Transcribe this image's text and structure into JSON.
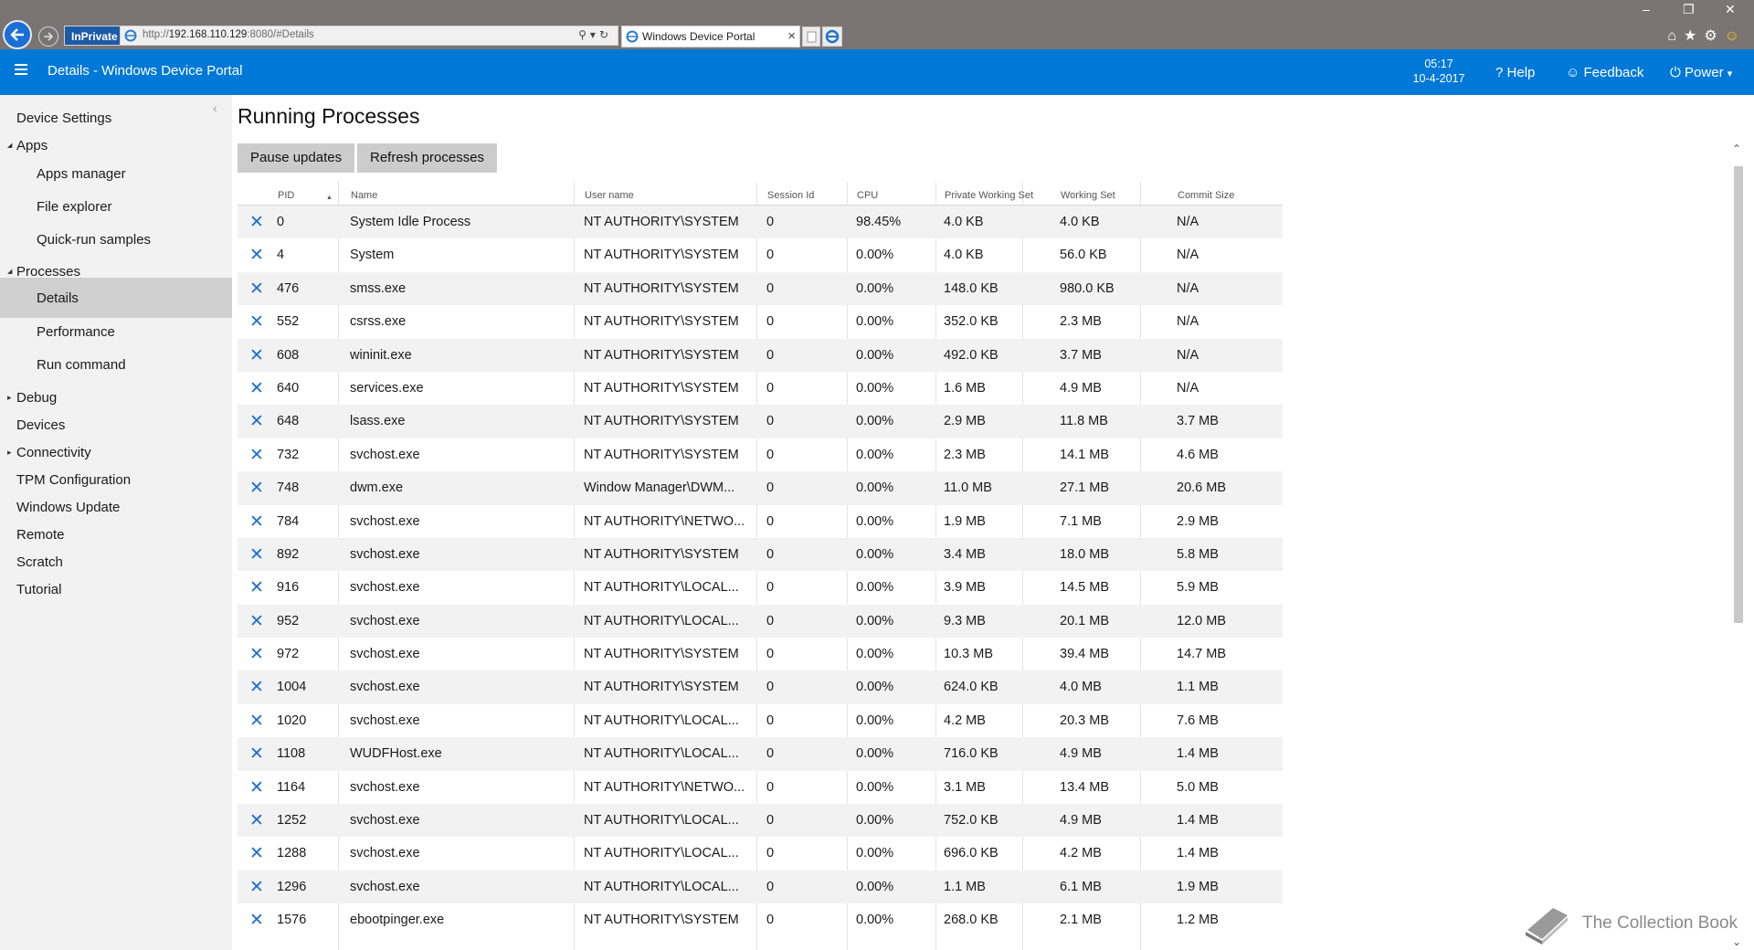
{
  "browser": {
    "inprivate_label": "InPrivate",
    "url_prefix": "http://",
    "url_host": "192.168.110.129",
    "url_suffix": ":8080/#Details",
    "tab_title": "Windows Device Portal"
  },
  "appbar": {
    "title": "Details - Windows Device Portal",
    "time": "05:17",
    "date": "10-4-2017",
    "help": "Help",
    "feedback": "Feedback",
    "power": "Power"
  },
  "sidebar": {
    "items": [
      {
        "label": "Device Settings",
        "level": 0,
        "caret": ""
      },
      {
        "label": "Apps",
        "level": 0,
        "caret": "down"
      },
      {
        "label": "Apps manager",
        "level": 1,
        "caret": ""
      },
      {
        "label": "File explorer",
        "level": 1,
        "caret": ""
      },
      {
        "label": "Quick-run samples",
        "level": 1,
        "caret": ""
      },
      {
        "label": "Processes",
        "level": 0,
        "caret": "down"
      },
      {
        "label": "Details",
        "level": 1,
        "caret": "",
        "active": true
      },
      {
        "label": "Performance",
        "level": 1,
        "caret": ""
      },
      {
        "label": "Run command",
        "level": 1,
        "caret": ""
      },
      {
        "label": "Debug",
        "level": 0,
        "caret": "right"
      },
      {
        "label": "Devices",
        "level": 0,
        "caret": ""
      },
      {
        "label": "Connectivity",
        "level": 0,
        "caret": "right"
      },
      {
        "label": "TPM Configuration",
        "level": 0,
        "caret": ""
      },
      {
        "label": "Windows Update",
        "level": 0,
        "caret": ""
      },
      {
        "label": "Remote",
        "level": 0,
        "caret": ""
      },
      {
        "label": "Scratch",
        "level": 0,
        "caret": ""
      },
      {
        "label": "Tutorial",
        "level": 0,
        "caret": ""
      }
    ]
  },
  "main": {
    "title": "Running Processes",
    "pause_label": "Pause updates",
    "refresh_label": "Refresh processes",
    "columns": [
      "PID",
      "Name",
      "User name",
      "Session Id",
      "CPU",
      "Private Working Set",
      "Working Set",
      "Commit Size"
    ],
    "rows": [
      [
        "0",
        "System Idle Process",
        "NT AUTHORITY\\SYSTEM",
        "0",
        "98.45%",
        "4.0 KB",
        "4.0 KB",
        "N/A"
      ],
      [
        "4",
        "System",
        "NT AUTHORITY\\SYSTEM",
        "0",
        "0.00%",
        "4.0 KB",
        "56.0 KB",
        "N/A"
      ],
      [
        "476",
        "smss.exe",
        "NT AUTHORITY\\SYSTEM",
        "0",
        "0.00%",
        "148.0 KB",
        "980.0 KB",
        "N/A"
      ],
      [
        "552",
        "csrss.exe",
        "NT AUTHORITY\\SYSTEM",
        "0",
        "0.00%",
        "352.0 KB",
        "2.3 MB",
        "N/A"
      ],
      [
        "608",
        "wininit.exe",
        "NT AUTHORITY\\SYSTEM",
        "0",
        "0.00%",
        "492.0 KB",
        "3.7 MB",
        "N/A"
      ],
      [
        "640",
        "services.exe",
        "NT AUTHORITY\\SYSTEM",
        "0",
        "0.00%",
        "1.6 MB",
        "4.9 MB",
        "N/A"
      ],
      [
        "648",
        "lsass.exe",
        "NT AUTHORITY\\SYSTEM",
        "0",
        "0.00%",
        "2.9 MB",
        "11.8 MB",
        "3.7 MB"
      ],
      [
        "732",
        "svchost.exe",
        "NT AUTHORITY\\SYSTEM",
        "0",
        "0.00%",
        "2.3 MB",
        "14.1 MB",
        "4.6 MB"
      ],
      [
        "748",
        "dwm.exe",
        "Window Manager\\DWM...",
        "0",
        "0.00%",
        "11.0 MB",
        "27.1 MB",
        "20.6 MB"
      ],
      [
        "784",
        "svchost.exe",
        "NT AUTHORITY\\NETWO...",
        "0",
        "0.00%",
        "1.9 MB",
        "7.1 MB",
        "2.9 MB"
      ],
      [
        "892",
        "svchost.exe",
        "NT AUTHORITY\\SYSTEM",
        "0",
        "0.00%",
        "3.4 MB",
        "18.0 MB",
        "5.8 MB"
      ],
      [
        "916",
        "svchost.exe",
        "NT AUTHORITY\\LOCAL...",
        "0",
        "0.00%",
        "3.9 MB",
        "14.5 MB",
        "5.9 MB"
      ],
      [
        "952",
        "svchost.exe",
        "NT AUTHORITY\\LOCAL...",
        "0",
        "0.00%",
        "9.3 MB",
        "20.1 MB",
        "12.0 MB"
      ],
      [
        "972",
        "svchost.exe",
        "NT AUTHORITY\\SYSTEM",
        "0",
        "0.00%",
        "10.3 MB",
        "39.4 MB",
        "14.7 MB"
      ],
      [
        "1004",
        "svchost.exe",
        "NT AUTHORITY\\SYSTEM",
        "0",
        "0.00%",
        "624.0 KB",
        "4.0 MB",
        "1.1 MB"
      ],
      [
        "1020",
        "svchost.exe",
        "NT AUTHORITY\\LOCAL...",
        "0",
        "0.00%",
        "4.2 MB",
        "20.3 MB",
        "7.6 MB"
      ],
      [
        "1108",
        "WUDFHost.exe",
        "NT AUTHORITY\\LOCAL...",
        "0",
        "0.00%",
        "716.0 KB",
        "4.9 MB",
        "1.4 MB"
      ],
      [
        "1164",
        "svchost.exe",
        "NT AUTHORITY\\NETWO...",
        "0",
        "0.00%",
        "3.1 MB",
        "13.4 MB",
        "5.0 MB"
      ],
      [
        "1252",
        "svchost.exe",
        "NT AUTHORITY\\LOCAL...",
        "0",
        "0.00%",
        "752.0 KB",
        "4.9 MB",
        "1.4 MB"
      ],
      [
        "1288",
        "svchost.exe",
        "NT AUTHORITY\\LOCAL...",
        "0",
        "0.00%",
        "696.0 KB",
        "4.2 MB",
        "1.4 MB"
      ],
      [
        "1296",
        "svchost.exe",
        "NT AUTHORITY\\LOCAL...",
        "0",
        "0.00%",
        "1.1 MB",
        "6.1 MB",
        "1.9 MB"
      ],
      [
        "1576",
        "ebootpinger.exe",
        "NT AUTHORITY\\SYSTEM",
        "0",
        "0.00%",
        "268.0 KB",
        "2.1 MB",
        "1.2 MB"
      ]
    ]
  },
  "watermark": "The Collection Book",
  "colors": {
    "accent": "#0078d7",
    "chrome": "#7a7574",
    "kill_icon": "#1c6fd0",
    "sidebar_bg": "#f2f2f2",
    "sidebar_active": "#cfcfcf",
    "button_bg": "#cccccc"
  }
}
